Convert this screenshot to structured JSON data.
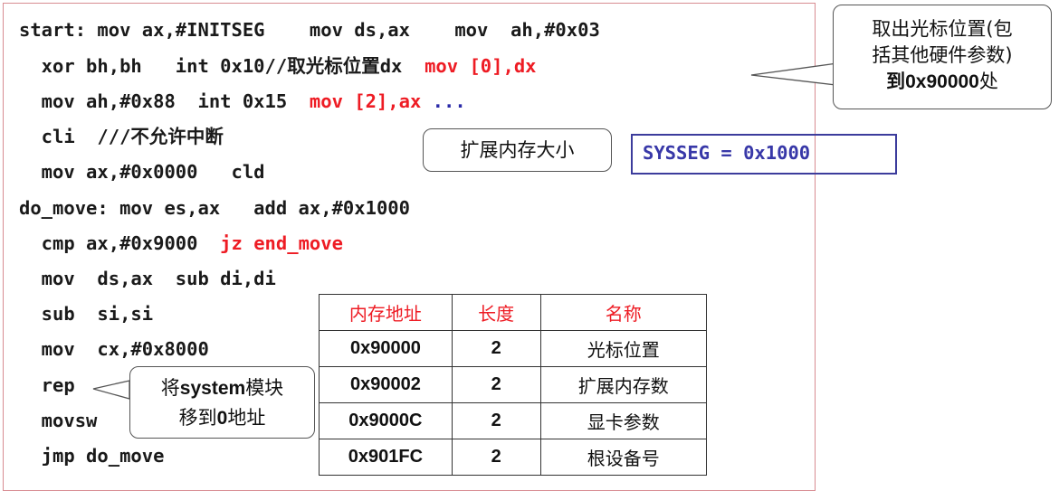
{
  "code_lines": [
    {
      "parts": [
        {
          "t": "start: mov ax,#INITSEG    mov ds,ax    mov  ah,#0x03",
          "c": ""
        }
      ]
    },
    {
      "parts": [
        {
          "t": "  xor bh,bh   int 0x10//取光标位置dx  ",
          "c": ""
        },
        {
          "t": "mov [0],dx",
          "c": "red"
        }
      ]
    },
    {
      "parts": [
        {
          "t": "  mov ah,#0x88  int 0x15  ",
          "c": ""
        },
        {
          "t": "mov [2],ax",
          "c": "red"
        },
        {
          "t": " ...",
          "c": "blue"
        }
      ]
    },
    {
      "parts": [
        {
          "t": "  cli  ///不允许中断",
          "c": ""
        }
      ]
    },
    {
      "parts": [
        {
          "t": "  mov ax,#0x0000   cld",
          "c": ""
        }
      ]
    },
    {
      "parts": [
        {
          "t": "do_move: mov es,ax   add ax,#0x1000",
          "c": ""
        }
      ]
    },
    {
      "parts": [
        {
          "t": "  cmp ax,#0x9000  ",
          "c": ""
        },
        {
          "t": "jz end_move",
          "c": "red"
        }
      ]
    },
    {
      "parts": [
        {
          "t": "  mov  ds,ax  sub di,di",
          "c": ""
        }
      ]
    },
    {
      "parts": [
        {
          "t": "  sub  si,si",
          "c": ""
        }
      ]
    },
    {
      "parts": [
        {
          "t": "  mov  cx,#0x8000",
          "c": ""
        }
      ]
    },
    {
      "parts": [
        {
          "t": "  rep",
          "c": ""
        }
      ]
    },
    {
      "parts": [
        {
          "t": "  movsw",
          "c": ""
        }
      ]
    },
    {
      "parts": [
        {
          "t": "  jmp do_move",
          "c": ""
        }
      ]
    }
  ],
  "callouts": {
    "cursor_line1": "取出光标位置(包",
    "cursor_line2": "括其他硬件参数)",
    "cursor_line3_num": "到0x90000",
    "cursor_line3_suffix": "处",
    "ext_mem": "扩展内存大小",
    "move_line1_a": "将",
    "move_line1_b": "system",
    "move_line1_c": "模块",
    "move_line2_a": "移到",
    "move_line2_b": "0",
    "move_line2_c": "地址"
  },
  "sysseg": "SYSSEG = 0x1000",
  "table": {
    "headers": [
      "内存地址",
      "长度",
      "名称"
    ],
    "rows": [
      [
        "0x90000",
        "2",
        "光标位置"
      ],
      [
        "0x90002",
        "2",
        "扩展内存数"
      ],
      [
        "0x9000C",
        "2",
        "显卡参数"
      ],
      [
        "0x901FC",
        "2",
        "根设备号"
      ]
    ]
  },
  "colors": {
    "accent_red": "#ee1c24",
    "frame_pink": "#d88c92",
    "sysseg_blue": "#3c3c9c"
  }
}
